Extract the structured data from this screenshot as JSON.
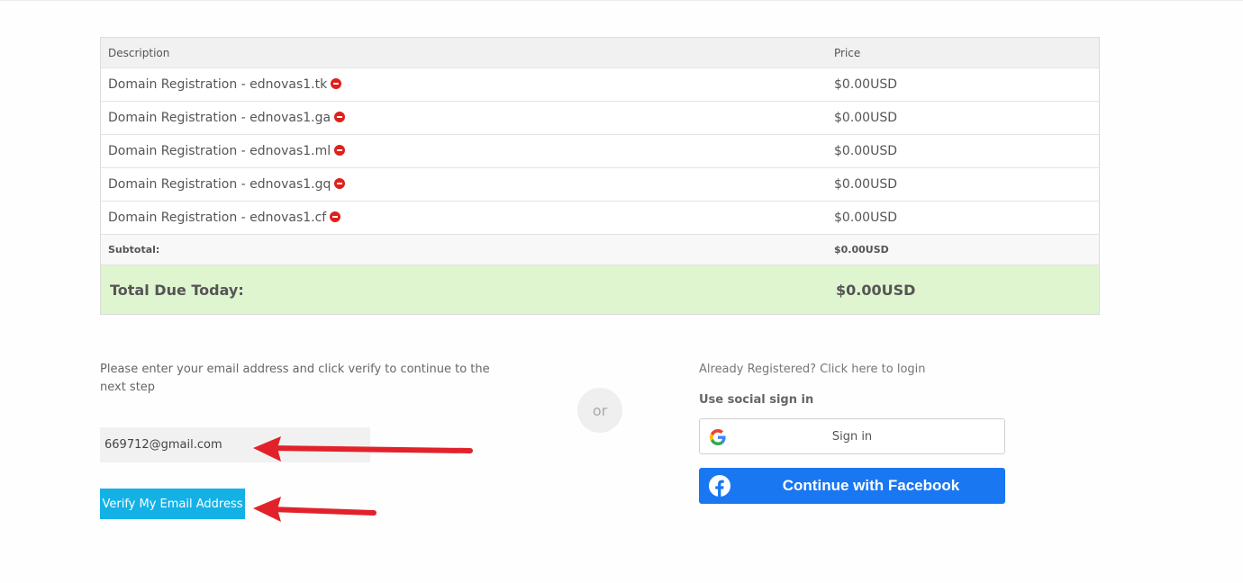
{
  "order_table": {
    "header": {
      "description": "Description",
      "price": "Price"
    },
    "items": [
      {
        "description": "Domain Registration - ednovas1.tk",
        "price": "$0.00USD"
      },
      {
        "description": "Domain Registration - ednovas1.ga",
        "price": "$0.00USD"
      },
      {
        "description": "Domain Registration - ednovas1.ml",
        "price": "$0.00USD"
      },
      {
        "description": "Domain Registration - ednovas1.gq",
        "price": "$0.00USD"
      },
      {
        "description": "Domain Registration - ednovas1.cf",
        "price": "$0.00USD"
      }
    ],
    "subtotal": {
      "label": "Subtotal:",
      "value": "$0.00USD"
    },
    "total": {
      "label": "Total Due Today:",
      "value": "$0.00USD"
    },
    "total_bg_color": "#dff5cf",
    "remove_icon_color": "#e0201c"
  },
  "email_section": {
    "intro": "Please enter your email address and click verify to continue to the next step",
    "email_value": "669712@gmail.com",
    "verify_label": "Verify My Email Address",
    "verify_color": "#14b1e7",
    "annotation_arrow_color": "#e2222a"
  },
  "divider": {
    "label": "or"
  },
  "login_section": {
    "login_link": "Already Registered? Click here to login",
    "social_title": "Use social sign in",
    "google_label": "Sign in",
    "google_icon": "google-g-icon",
    "facebook_label": "Continue with Facebook",
    "facebook_icon": "facebook-f-icon",
    "facebook_color": "#1a77f2"
  }
}
